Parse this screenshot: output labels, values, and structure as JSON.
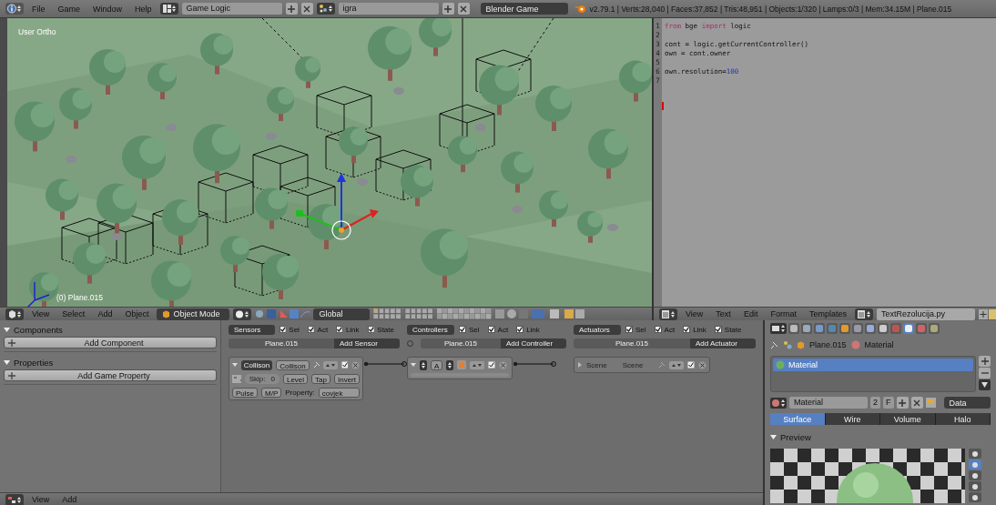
{
  "top_bar": {
    "menus": [
      "File",
      "Game",
      "Window",
      "Help"
    ],
    "screen_layout": "Game Logic",
    "scene": "igra",
    "engine": "Blender Game",
    "stats": "v2.79.1 | Verts:28,040 | Faces:37,852 | Tris:48,951 | Objects:1/320 | Lamps:0/3 | Mem:34.15M | Plane.015"
  },
  "viewport": {
    "view_label": "User Ortho",
    "object_label": "(0) Plane.015",
    "menus": [
      "View",
      "Select",
      "Add",
      "Object"
    ],
    "mode": "Object Mode",
    "orientation": "Global"
  },
  "text_editor": {
    "lines": [
      {
        "number": "1",
        "tokens": [
          {
            "text": "from",
            "kind": "keyword"
          },
          {
            "text": " bge ",
            "kind": "plain"
          },
          {
            "text": "import",
            "kind": "keyword"
          },
          {
            "text": " logic",
            "kind": "plain"
          }
        ]
      },
      {
        "number": "2"
      },
      {
        "number": "3",
        "tokens": [
          {
            "text": "cont = logic.getCurrentController()",
            "kind": "plain"
          }
        ]
      },
      {
        "number": "4",
        "tokens": [
          {
            "text": "own = cont.owner",
            "kind": "plain"
          }
        ]
      },
      {
        "number": "5"
      },
      {
        "number": "6",
        "tokens": [
          {
            "text": "own.resolution=",
            "kind": "plain"
          },
          {
            "text": "100",
            "kind": "number"
          }
        ]
      },
      {
        "number": "7"
      }
    ],
    "menus": [
      "View",
      "Text",
      "Edit",
      "Format",
      "Templates"
    ],
    "file_name": "TextRezolucija.py"
  },
  "logic_editor": {
    "panels": [
      {
        "title": "Components",
        "button": "Add Component",
        "expanded": true
      },
      {
        "title": "Properties",
        "button": "Add Game Property",
        "expanded": true
      }
    ],
    "columns": [
      {
        "kind": "sensors",
        "type_label": "Sensors",
        "filters": [
          {
            "label": "Sel",
            "checked": true
          },
          {
            "label": "Act",
            "checked": true
          },
          {
            "label": "Link",
            "checked": true
          },
          {
            "label": "State",
            "checked": true
          }
        ],
        "object": "Plane.015",
        "add_label": "Add Sensor"
      },
      {
        "kind": "controllers",
        "type_label": "Controllers",
        "filters": [
          {
            "label": "Sel",
            "checked": true
          },
          {
            "label": "Act",
            "checked": true
          },
          {
            "label": "Link",
            "checked": true
          }
        ],
        "object": "Plane.015",
        "add_label": "Add Controller"
      },
      {
        "kind": "actuators",
        "type_label": "Actuators",
        "filters": [
          {
            "label": "Sel",
            "checked": true
          },
          {
            "label": "Act",
            "checked": true
          },
          {
            "label": "Link",
            "checked": true
          },
          {
            "label": "State",
            "checked": true
          }
        ],
        "object": "Plane.015",
        "add_label": "Add Actuator"
      }
    ],
    "sensor": {
      "type": "Collison",
      "name": "Collison",
      "skip_label": "Skip:",
      "skip_value": "0",
      "level": "Level",
      "tap": "Tap",
      "invert": "Invert",
      "pulse": "Pulse",
      "mp": "M/P",
      "property_label": "Property:",
      "property_value": "covjek"
    },
    "controller": {
      "label": "A"
    },
    "actuator": {
      "scene_label": "Scene",
      "scene_value": "Scene"
    },
    "footer_menus": [
      "View",
      "Add"
    ]
  },
  "properties": {
    "context_tabs": [
      {
        "selected": false
      },
      {
        "selected": false
      },
      {
        "selected": false
      },
      {
        "selected": false
      },
      {
        "selected": false
      },
      {
        "selected": false
      },
      {
        "selected": false
      },
      {
        "selected": false
      },
      {
        "selected": false
      },
      {
        "selected": true
      },
      {
        "selected": false
      },
      {
        "selected": false
      }
    ],
    "breadcrumb": [
      "Plane.015",
      "Material"
    ],
    "material_slots": [
      {
        "name": "Material",
        "selected": true
      }
    ],
    "material_name": "Material",
    "users": "2",
    "fake_user": "F",
    "link": "Data",
    "tabs": [
      {
        "label": "Surface",
        "selected": true
      },
      {
        "label": "Wire",
        "selected": false
      },
      {
        "label": "Volume",
        "selected": false
      },
      {
        "label": "Halo",
        "selected": false
      }
    ],
    "preview_title": "Preview",
    "preview_shapes": [
      {
        "selected": false
      },
      {
        "selected": true
      },
      {
        "selected": false
      },
      {
        "selected": false
      },
      {
        "selected": false
      }
    ]
  }
}
